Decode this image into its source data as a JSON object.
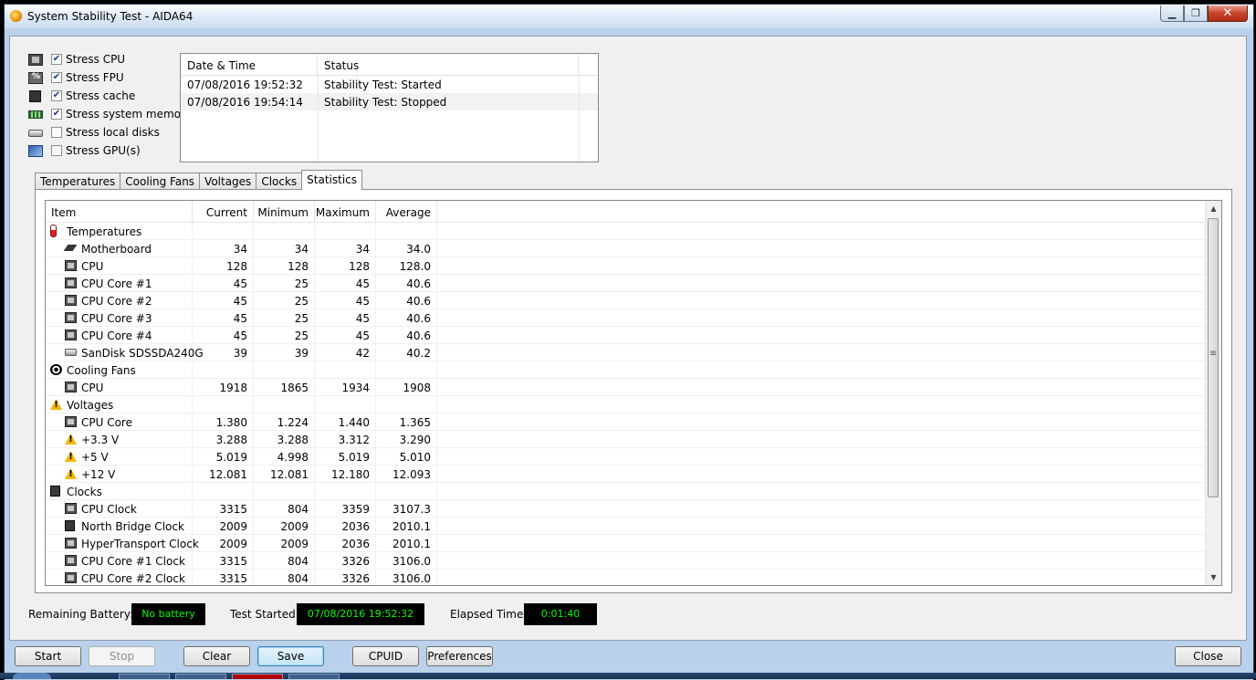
{
  "window": {
    "title": "System Stability Test - AIDA64",
    "caption_minimize": "▁",
    "caption_maximize": "❐",
    "caption_close": "✕"
  },
  "stress": [
    {
      "label": "Stress CPU",
      "checked": true,
      "icon": "cpu-icon"
    },
    {
      "label": "Stress FPU",
      "checked": true,
      "icon": "fpu-icon"
    },
    {
      "label": "Stress cache",
      "checked": true,
      "icon": "cache-icon"
    },
    {
      "label": "Stress system memory",
      "checked": true,
      "icon": "memory-icon"
    },
    {
      "label": "Stress local disks",
      "checked": false,
      "icon": "disk-icon"
    },
    {
      "label": "Stress GPU(s)",
      "checked": false,
      "icon": "gpu-icon"
    }
  ],
  "log": {
    "headers": [
      "Date & Time",
      "Status"
    ],
    "rows": [
      [
        "07/08/2016 19:52:32",
        "Stability Test: Started"
      ],
      [
        "07/08/2016 19:54:14",
        "Stability Test: Stopped"
      ]
    ]
  },
  "tabs": [
    "Temperatures",
    "Cooling Fans",
    "Voltages",
    "Clocks",
    "Statistics"
  ],
  "active_tab": "Statistics",
  "stats": {
    "headers": [
      "Item",
      "Current",
      "Minimum",
      "Maximum",
      "Average"
    ],
    "rows": [
      {
        "level": 0,
        "icon": "thermometer-icon",
        "item": "Temperatures",
        "current": "",
        "min": "",
        "max": "",
        "avg": ""
      },
      {
        "level": 1,
        "icon": "motherboard-icon",
        "item": "Motherboard",
        "current": "34",
        "min": "34",
        "max": "34",
        "avg": "34.0"
      },
      {
        "level": 1,
        "icon": "chip-icon",
        "item": "CPU",
        "current": "128",
        "min": "128",
        "max": "128",
        "avg": "128.0"
      },
      {
        "level": 1,
        "icon": "chip-icon",
        "item": "CPU Core #1",
        "current": "45",
        "min": "25",
        "max": "45",
        "avg": "40.6"
      },
      {
        "level": 1,
        "icon": "chip-icon",
        "item": "CPU Core #2",
        "current": "45",
        "min": "25",
        "max": "45",
        "avg": "40.6"
      },
      {
        "level": 1,
        "icon": "chip-icon",
        "item": "CPU Core #3",
        "current": "45",
        "min": "25",
        "max": "45",
        "avg": "40.6"
      },
      {
        "level": 1,
        "icon": "chip-icon",
        "item": "CPU Core #4",
        "current": "45",
        "min": "25",
        "max": "45",
        "avg": "40.6"
      },
      {
        "level": 1,
        "icon": "disk-icon",
        "item": "SanDisk SDSSDA240G",
        "current": "39",
        "min": "39",
        "max": "42",
        "avg": "40.2"
      },
      {
        "level": 0,
        "icon": "fan-icon",
        "item": "Cooling Fans",
        "current": "",
        "min": "",
        "max": "",
        "avg": ""
      },
      {
        "level": 1,
        "icon": "chip-icon",
        "item": "CPU",
        "current": "1918",
        "min": "1865",
        "max": "1934",
        "avg": "1908"
      },
      {
        "level": 0,
        "icon": "warning-icon",
        "item": "Voltages",
        "current": "",
        "min": "",
        "max": "",
        "avg": ""
      },
      {
        "level": 1,
        "icon": "chip-icon",
        "item": "CPU Core",
        "current": "1.380",
        "min": "1.224",
        "max": "1.440",
        "avg": "1.365"
      },
      {
        "level": 1,
        "icon": "warning-icon",
        "item": "+3.3 V",
        "current": "3.288",
        "min": "3.288",
        "max": "3.312",
        "avg": "3.290"
      },
      {
        "level": 1,
        "icon": "warning-icon",
        "item": "+5 V",
        "current": "5.019",
        "min": "4.998",
        "max": "5.019",
        "avg": "5.010"
      },
      {
        "level": 1,
        "icon": "warning-icon",
        "item": "+12 V",
        "current": "12.081",
        "min": "12.081",
        "max": "12.180",
        "avg": "12.093"
      },
      {
        "level": 0,
        "icon": "clock-chip-icon",
        "item": "Clocks",
        "current": "",
        "min": "",
        "max": "",
        "avg": ""
      },
      {
        "level": 1,
        "icon": "chip-icon",
        "item": "CPU Clock",
        "current": "3315",
        "min": "804",
        "max": "3359",
        "avg": "3107.3"
      },
      {
        "level": 1,
        "icon": "clock-chip-icon",
        "item": "North Bridge Clock",
        "current": "2009",
        "min": "2009",
        "max": "2036",
        "avg": "2010.1"
      },
      {
        "level": 1,
        "icon": "chip-icon",
        "item": "HyperTransport Clock",
        "current": "2009",
        "min": "2009",
        "max": "2036",
        "avg": "2010.1"
      },
      {
        "level": 1,
        "icon": "chip-icon",
        "item": "CPU Core #1 Clock",
        "current": "3315",
        "min": "804",
        "max": "3326",
        "avg": "3106.0"
      },
      {
        "level": 1,
        "icon": "chip-icon",
        "item": "CPU Core #2 Clock",
        "current": "3315",
        "min": "804",
        "max": "3326",
        "avg": "3106.0"
      }
    ]
  },
  "status": {
    "battery_label": "Remaining Battery:",
    "battery_value": "No battery",
    "started_label": "Test Started:",
    "started_value": "07/08/2016 19:52:32",
    "elapsed_label": "Elapsed Time:",
    "elapsed_value": "0:01:40"
  },
  "buttons": {
    "start": "Start",
    "stop": "Stop",
    "clear": "Clear",
    "save": "Save",
    "cpuid": "CPUID",
    "preferences": "Preferences",
    "close": "Close"
  },
  "colors": {
    "status_text": "#00ff00",
    "status_bg": "#000000",
    "title_gradient_top": "#ffffff",
    "close_button": "#c7442a"
  }
}
